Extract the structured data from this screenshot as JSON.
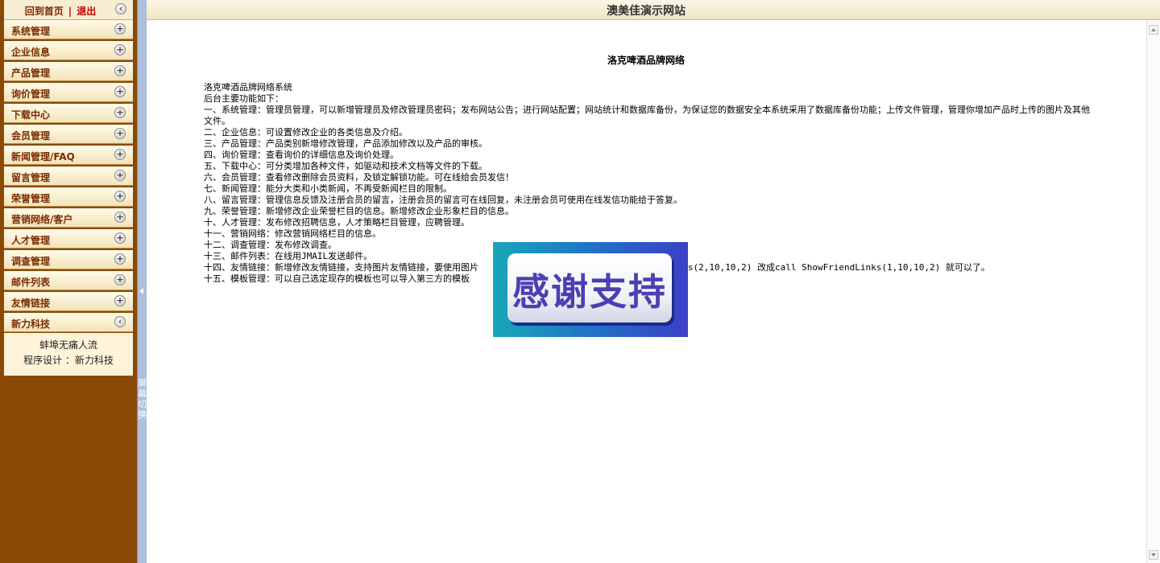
{
  "site_title": "澳美佳演示网站",
  "top_links": {
    "home": "回到首页",
    "separator": "|",
    "logout": "退出"
  },
  "menu": [
    "系统管理",
    "企业信息",
    "产品管理",
    "询价管理",
    "下载中心",
    "会员管理",
    "新闻管理/FAQ",
    "留言管理",
    "荣誉管理",
    "营销网络/客户",
    "人才管理",
    "调查管理",
    "邮件列表",
    "友情链接"
  ],
  "info_section": {
    "title": "新力科技",
    "line1": "蚌埠无痛人流",
    "line2": "程序设计 ：新力科技"
  },
  "splitter_text": "屏幕切换",
  "main": {
    "heading": "洛克啤酒品牌网络",
    "intro1": "洛克啤酒品牌网络系统",
    "intro2": "后台主要功能如下：",
    "items": [
      "一、系统管理：管理员管理，可以新增管理员及修改管理员密码；发布网站公告；进行网站配置；网站统计和数据库备份，为保证您的数据安全本系统采用了数据库备份功能；上传文件管理，管理你增加产品时上传的图片及其他文件。",
      "二、企业信息：可设置修改企业的各类信息及介绍。",
      "三、产品管理：产品类别新增修改管理，产品添加修改以及产品的审核。",
      "四、询价管理：查看询价的详细信息及询价处理。",
      "五、下载中心：可分类增加各种文件，如驱动和技术文档等文件的下载。",
      "六、会员管理：查看修改删除会员资料，及锁定解锁功能。可在线给会员发信！",
      "七、新闻管理：能分大类和小类新闻，不再受新闻栏目的限制。",
      "八、留言管理：管理信息反馈及注册会员的留言，注册会员的留言可在线回复，未注册会员可使用在线发信功能给于答复。",
      "九、荣誉管理：新增修改企业荣誉栏目的信息。新增修改企业形象栏目的信息。",
      "十、人才管理：发布修改招聘信息，人才策略栏目管理，应聘管理。",
      "十一、营销网络：修改营销网络栏目的信息。",
      "十二、调查管理：发布修改调查。",
      "十三、邮件列表：在线用JMAIL发送邮件。",
      "十四、友情链接：新增修改友情链接，支持图片友情链接，要使用图片",
      "十五、模板管理：可以自己选定现存的模板也可以导入第三方的模板"
    ],
    "item14_tail": "inks(2,10,10,2) 改成call ShowFriendLinks(1,10,10,2) 就可以了。"
  },
  "overlay": {
    "text": "感谢支持"
  },
  "icons": {
    "collapse": "collapse-left-icon",
    "expand": "plus-icon"
  }
}
